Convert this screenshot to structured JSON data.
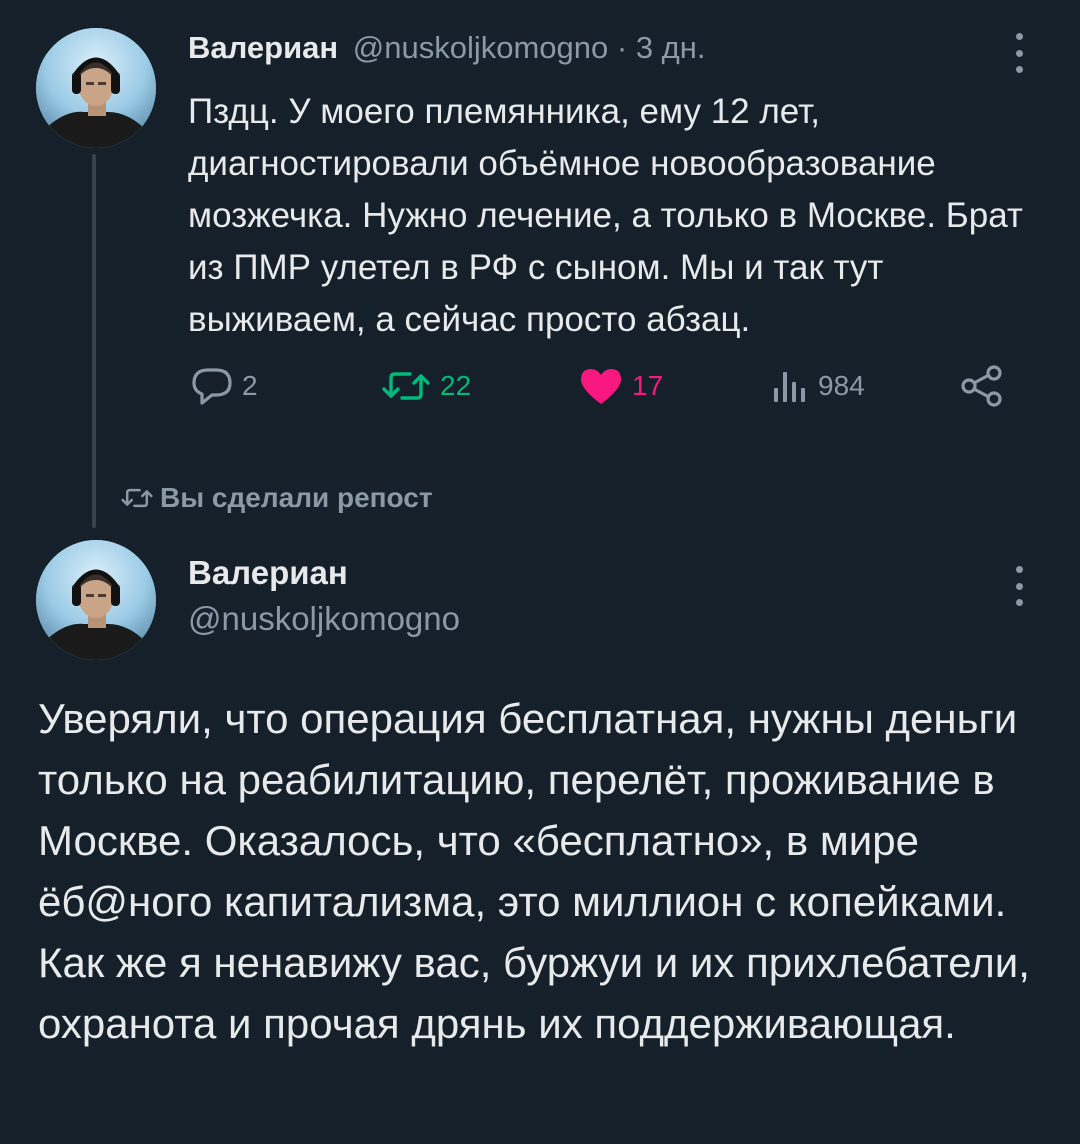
{
  "tweet1": {
    "author_name": "Валериан",
    "author_handle": "@nuskoljkomogno",
    "separator": "·",
    "timestamp": "3 дн.",
    "text": "Пздц. У моего племянника, ему 12 лет, диагностировали объёмное новообразование мозжечка. Нужно лечение, а только в Москве. Брат из ПМР улетел в РФ с сыном. Мы и так тут выживаем, а сейчас просто абзац.",
    "actions": {
      "reply_count": "2",
      "retweet_count": "22",
      "like_count": "17",
      "views_count": "984"
    },
    "icons": [
      "reply-icon",
      "retweet-icon",
      "like-icon",
      "views-icon",
      "share-icon",
      "more-icon"
    ]
  },
  "repost_note": "Вы сделали репост",
  "tweet2": {
    "author_name": "Валериан",
    "author_handle": "@nuskoljkomogno",
    "text": "Уверяли, что операция бесплатная, нужны деньги только на реабилитацию, перелёт, проживание в Москве. Оказалось, что «бесплатно», в мире ёб@ного капитализма, это миллион с копейками. Как же я ненавижу вас, буржуи и их прихлебатели, охранота и прочая дрянь их поддерживающая."
  },
  "colors": {
    "background": "#15202b",
    "text": "#e7e9ea",
    "muted": "#8b98a5",
    "retweet_green": "#00ba7c",
    "like_pink": "#f91880",
    "thread_line": "#38444d"
  }
}
